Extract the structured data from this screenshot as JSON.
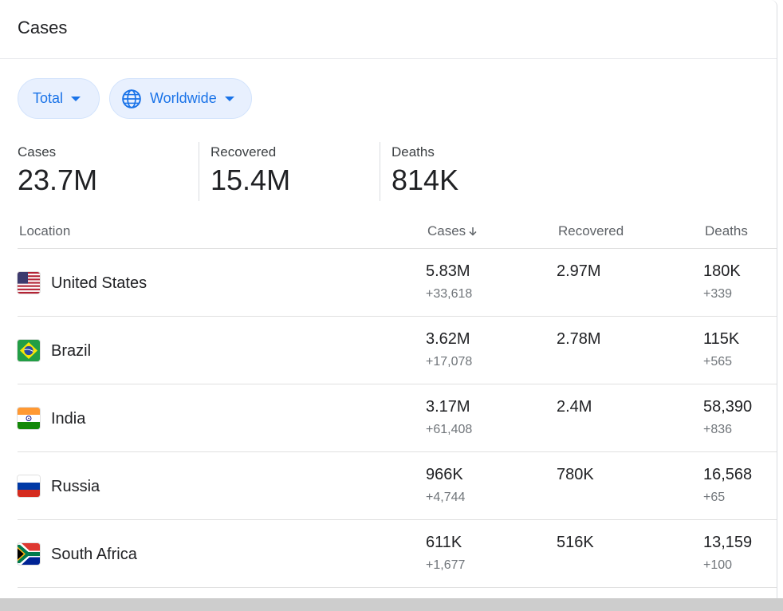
{
  "card": {
    "title": "Cases"
  },
  "filters": {
    "total_label": "Total",
    "worldwide_label": "Worldwide"
  },
  "stats": [
    {
      "label": "Cases",
      "value": "23.7M"
    },
    {
      "label": "Recovered",
      "value": "15.4M"
    },
    {
      "label": "Deaths",
      "value": "814K"
    }
  ],
  "table": {
    "headers": {
      "location": "Location",
      "cases": "Cases",
      "recovered": "Recovered",
      "deaths": "Deaths"
    },
    "rows": [
      {
        "country": "United States",
        "flag": "us-flag",
        "cases": "5.83M",
        "cases_new": "+33,618",
        "recovered": "2.97M",
        "deaths": "180K",
        "deaths_new": "+339"
      },
      {
        "country": "Brazil",
        "flag": "brazil-flag",
        "cases": "3.62M",
        "cases_new": "+17,078",
        "recovered": "2.78M",
        "deaths": "115K",
        "deaths_new": "+565"
      },
      {
        "country": "India",
        "flag": "india-flag",
        "cases": "3.17M",
        "cases_new": "+61,408",
        "recovered": "2.4M",
        "deaths": "58,390",
        "deaths_new": "+836"
      },
      {
        "country": "Russia",
        "flag": "russia-flag",
        "cases": "966K",
        "cases_new": "+4,744",
        "recovered": "780K",
        "deaths": "16,568",
        "deaths_new": "+65"
      },
      {
        "country": "South Africa",
        "flag": "south-africa-flag",
        "cases": "611K",
        "cases_new": "+1,677",
        "recovered": "516K",
        "deaths": "13,159",
        "deaths_new": "+100"
      }
    ]
  },
  "colors": {
    "accent": "#1a73e8",
    "chip_bg": "#e8f0fe",
    "text": "#202124",
    "muted": "#70757a"
  }
}
